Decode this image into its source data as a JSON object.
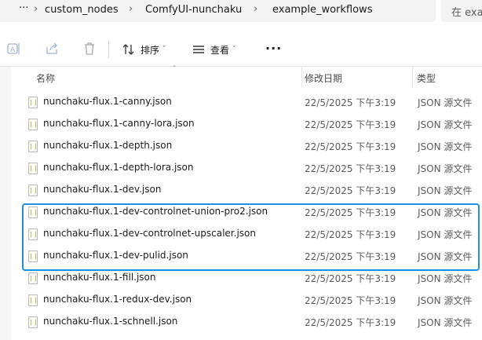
{
  "address_bar": {
    "ellipsis": "···",
    "crumbs": [
      "custom_nodes",
      "ComfyUI-nunchaku",
      "example_workflows"
    ],
    "search_placeholder": "在 exa"
  },
  "toolbar": {
    "sort_label": "排序",
    "view_label": "查看",
    "more_label": "···"
  },
  "columns": {
    "name": "名称",
    "modified": "修改日期",
    "type": "类型"
  },
  "files": [
    {
      "name": "nunchaku-flux.1-canny.json",
      "modified": "22/5/2025 下午3:19",
      "type": "JSON 源文件"
    },
    {
      "name": "nunchaku-flux.1-canny-lora.json",
      "modified": "22/5/2025 下午3:19",
      "type": "JSON 源文件"
    },
    {
      "name": "nunchaku-flux.1-depth.json",
      "modified": "22/5/2025 下午3:19",
      "type": "JSON 源文件"
    },
    {
      "name": "nunchaku-flux.1-depth-lora.json",
      "modified": "22/5/2025 下午3:19",
      "type": "JSON 源文件"
    },
    {
      "name": "nunchaku-flux.1-dev.json",
      "modified": "22/5/2025 下午3:19",
      "type": "JSON 源文件"
    },
    {
      "name": "nunchaku-flux.1-dev-controlnet-union-pro2.json",
      "modified": "22/5/2025 下午3:19",
      "type": "JSON 源文件"
    },
    {
      "name": "nunchaku-flux.1-dev-controlnet-upscaler.json",
      "modified": "22/5/2025 下午3:19",
      "type": "JSON 源文件"
    },
    {
      "name": "nunchaku-flux.1-dev-pulid.json",
      "modified": "22/5/2025 下午3:19",
      "type": "JSON 源文件"
    },
    {
      "name": "nunchaku-flux.1-fill.json",
      "modified": "22/5/2025 下午3:19",
      "type": "JSON 源文件"
    },
    {
      "name": "nunchaku-flux.1-redux-dev.json",
      "modified": "22/5/2025 下午3:19",
      "type": "JSON 源文件"
    },
    {
      "name": "nunchaku-flux.1-schnell.json",
      "modified": "22/5/2025 下午3:19",
      "type": "JSON 源文件"
    }
  ],
  "colors": {
    "highlight_border": "#1e90e6",
    "address_bg": "#f3f3f3"
  }
}
